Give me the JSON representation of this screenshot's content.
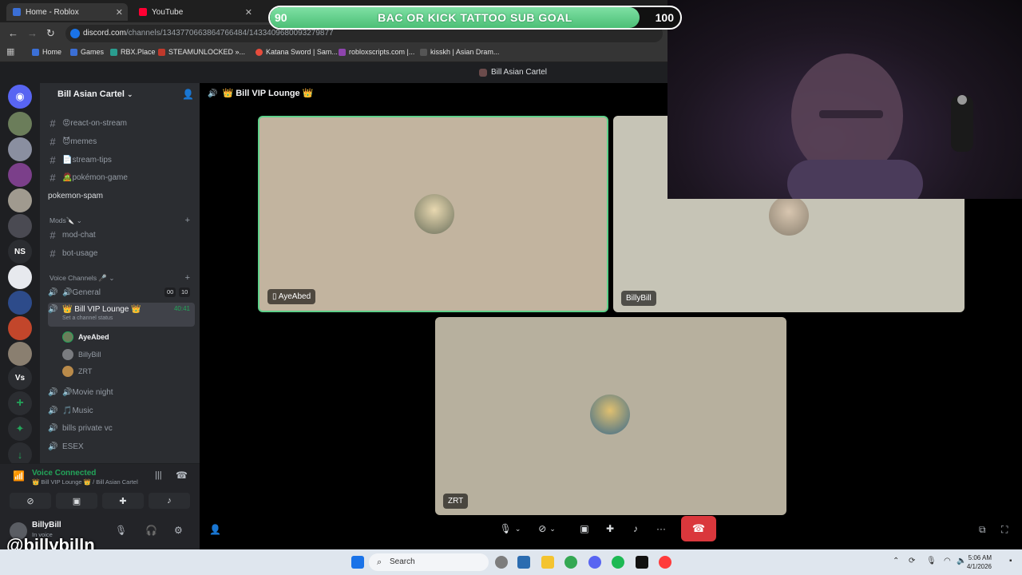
{
  "browser": {
    "tabs": [
      {
        "title": "Home - Roblox"
      },
      {
        "title": "YouTube"
      }
    ],
    "url_host": "discord.com",
    "url_path": "/channels/1343770663864766484/1433409680093279877",
    "bookmarks": [
      "Home",
      "Games",
      "RBX.Place",
      "STEAMUNLOCKED »...",
      "Katana Sword | Sam...",
      "robloxscripts.com |...",
      "kisskh | Asian Dram..."
    ]
  },
  "overlay": {
    "goal_title": "BAC OR KICK TATTOO SUB GOAL",
    "goal_current": "90",
    "goal_target": "100",
    "goal_progress": 0.9,
    "handle": "@billybilln"
  },
  "discord": {
    "window_title": "Bill Asian Cartel",
    "server_name": "Bill Asian Cartel",
    "channels": [
      {
        "label": "😡react-on-stream",
        "type": "text"
      },
      {
        "label": "😈memes",
        "type": "text"
      },
      {
        "label": "📄stream-tips",
        "type": "text"
      },
      {
        "label": "🧟pokémon-game",
        "type": "text"
      },
      {
        "label": "pokemon-spam",
        "type": "text"
      }
    ],
    "mods_category": "Mods🔪",
    "mod_channels": [
      {
        "label": "mod-chat"
      },
      {
        "label": "bot-usage"
      }
    ],
    "voice_category": "Voice Channels 🎤",
    "voice_channels": {
      "general": {
        "label": "🔊General",
        "count_a": "00",
        "count_b": "10"
      },
      "vip": {
        "label": "👑 Bill VIP Lounge 👑",
        "timer": "40:41",
        "status": "Set a channel status"
      },
      "movie": {
        "label": "🔊Movie night"
      },
      "music": {
        "label": "🎵Music"
      },
      "private": {
        "label": "bills private vc"
      },
      "esex": {
        "label": "ESEX"
      }
    },
    "voice_users": [
      "AyeAbed",
      "BillyBill",
      "ZRT"
    ],
    "voice_panel": {
      "status": "Voice Connected",
      "location": "👑 Bill VIP Lounge 👑 / Bill Asian Cartel"
    },
    "user": {
      "name": "BillyBill",
      "status": "In voice"
    },
    "stage_title": "👑 Bill VIP Lounge 👑",
    "participants": [
      {
        "name": "AyeAbed",
        "bg": "#c2b49f",
        "mobile": true
      },
      {
        "name": "BillyBill",
        "bg": "#c6c4b6",
        "mobile": false
      },
      {
        "name": "ZRT",
        "bg": "#b7b09e",
        "mobile": false
      }
    ]
  },
  "taskbar": {
    "search_placeholder": "Search",
    "time": "5:06 AM",
    "date": "4/1/2026"
  },
  "colors": {
    "accent_green": "#23a55a",
    "end_call_red": "#da373c",
    "goal_fill": "#5fd08a"
  }
}
